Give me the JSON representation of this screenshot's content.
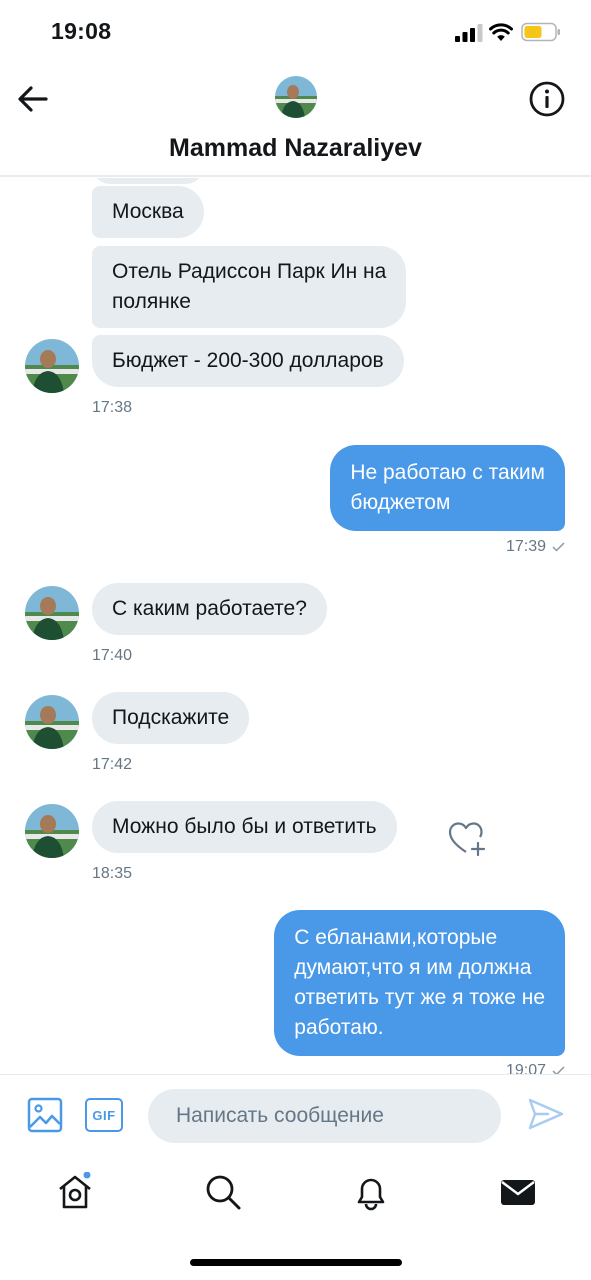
{
  "status_bar": {
    "time": "19:08"
  },
  "header": {
    "name": "Mammad Nazaraliyev"
  },
  "messages": [
    {
      "side": "in",
      "lines": [
        "Москва"
      ]
    },
    {
      "side": "in",
      "lines": [
        "Отель Радиссон Парк Ин на",
        "полянке"
      ]
    },
    {
      "side": "in",
      "lines": [
        "Бюджет - 200-300 долларов"
      ],
      "time": "17:38"
    },
    {
      "side": "out",
      "lines": [
        "Не работаю с таким",
        "бюджетом"
      ],
      "time": "17:39"
    },
    {
      "side": "in",
      "lines": [
        "С каким работаете?"
      ],
      "time": "17:40"
    },
    {
      "side": "in",
      "lines": [
        "Подскажите"
      ],
      "time": "17:42"
    },
    {
      "side": "in",
      "lines": [
        "Можно было бы и ответить"
      ],
      "time": "18:35"
    },
    {
      "side": "out",
      "lines": [
        "С ебланами,которые",
        "думают,что я им должна",
        "ответить тут же я тоже не",
        "работаю."
      ],
      "time": "19:07"
    }
  ],
  "composer": {
    "placeholder": "Написать сообщение",
    "gif_label": "GIF"
  },
  "icons": {
    "back": "arrow-left-icon",
    "info": "info-icon",
    "image": "image-icon",
    "send": "send-icon",
    "like": "heart-plus-icon",
    "home": "home-icon",
    "search": "search-icon",
    "notifications": "bell-icon",
    "messages": "envelope-icon"
  },
  "colors": {
    "accent": "#4a99e9",
    "bubble_in": "#e6ecf0",
    "text": "#14171a",
    "muted": "#657786"
  }
}
